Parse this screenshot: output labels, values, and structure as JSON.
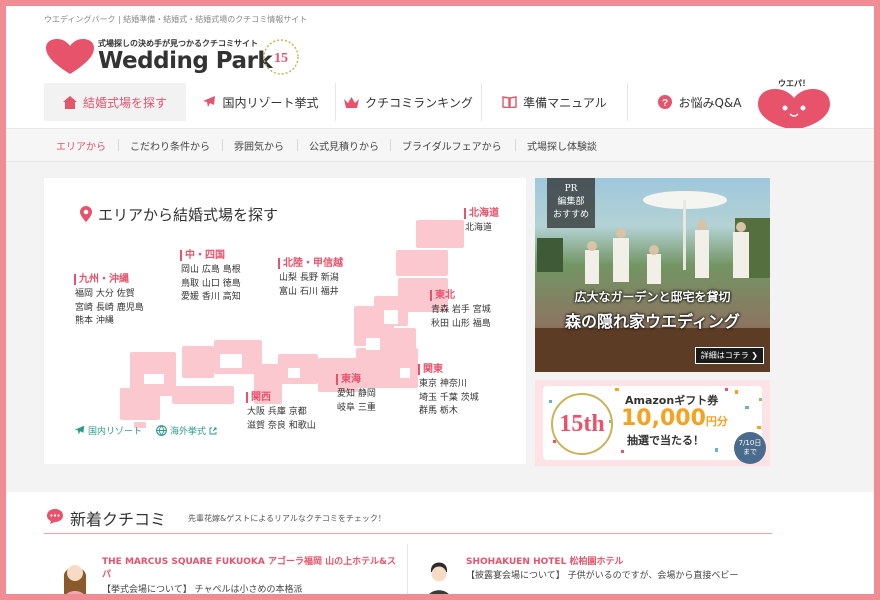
{
  "header": {
    "tagline": "ウエディングパーク | 結婚準備・結婚式・結婚式場のクチコミ情報サイト",
    "logo_catch": "式場探しの決め手が見つかるクチコミサイト",
    "logo_word": "Wedding Park",
    "badge": "15th"
  },
  "nav": {
    "items": [
      {
        "label": "結婚式場を探す",
        "icon": "house-icon"
      },
      {
        "label": "国内リゾート挙式",
        "icon": "airplane-icon"
      },
      {
        "label": "クチコミランキング",
        "icon": "crown-icon"
      },
      {
        "label": "準備マニュアル",
        "icon": "book-icon"
      },
      {
        "label": "お悩みQ&A",
        "icon": "question-icon"
      }
    ],
    "mascot_label": "ウエパ！"
  },
  "subnav": {
    "items": [
      "エリアから",
      "こだわり条件から",
      "雰囲気から",
      "公式見積りから",
      "ブライダルフェアから",
      "式場探し体験談"
    ]
  },
  "area": {
    "title": "エリアから結婚式場を探す",
    "regions": {
      "kyushu": {
        "name": "九州・沖縄",
        "lines": [
          "福岡 大分 佐賀",
          "宮崎 長崎 鹿児島",
          "熊本 沖縄"
        ]
      },
      "chugoku": {
        "name": "中・四国",
        "lines": [
          "岡山 広島 島根",
          "鳥取 山口 徳島",
          "愛媛 香川 高知"
        ]
      },
      "hokuriku": {
        "name": "北陸・甲信越",
        "lines": [
          "山梨 長野 新潟",
          "富山 石川 福井"
        ]
      },
      "hokkaido": {
        "name": "北海道",
        "lines": [
          "北海道"
        ]
      },
      "tohoku": {
        "name": "東北",
        "lines": [
          "青森 岩手 宮城",
          "秋田 山形 福島"
        ]
      },
      "kansai": {
        "name": "関西",
        "lines": [
          "大阪 兵庫 京都",
          "滋賀 奈良 和歌山"
        ]
      },
      "tokai": {
        "name": "東海",
        "lines": [
          "愛知 静岡",
          "岐阜 三重"
        ]
      },
      "kanto": {
        "name": "関東",
        "lines": [
          "東京 神奈川",
          "埼玉 千葉 茨城",
          "群馬 栃木"
        ]
      }
    },
    "links": {
      "domestic_resort": "国内リゾート",
      "overseas": "海外挙式"
    }
  },
  "pr_banner": {
    "tag_line1": "PR",
    "tag_line2": "編集部",
    "tag_line3": "おすすめ",
    "caption1": "広大なガーデンと邸宅を貸切",
    "caption2": "森の隠れ家ウエディング",
    "more": "詳細はコチラ"
  },
  "amazon_banner": {
    "badge": "15th",
    "line1": "Amazonギフト券",
    "amount": "10,000",
    "unit": "円分",
    "line3": "抽選で当たる！",
    "date_line1": "7/10日",
    "date_line2": "まで"
  },
  "reviews": {
    "heading": "新着クチコミ",
    "subheading": "先輩花嫁&ゲストによるリアルなクチコミをチェック！",
    "items": [
      {
        "venue": "THE MARCUS SQUARE FUKUOKA アゴーラ福岡 山の上ホテル&スパ",
        "text": "【挙式会場について】 チャペルは小さめの本格派"
      },
      {
        "venue": "SHOHAKUEN HOTEL 松柏園ホテル",
        "text": "【披露宴会場について】 子供がいるのですが、会場から直接ベビー"
      }
    ]
  },
  "colors": {
    "accent": "#e8536c",
    "frame": "#f08c94",
    "map": "#fcc8d0",
    "link": "#2c9c8a"
  }
}
